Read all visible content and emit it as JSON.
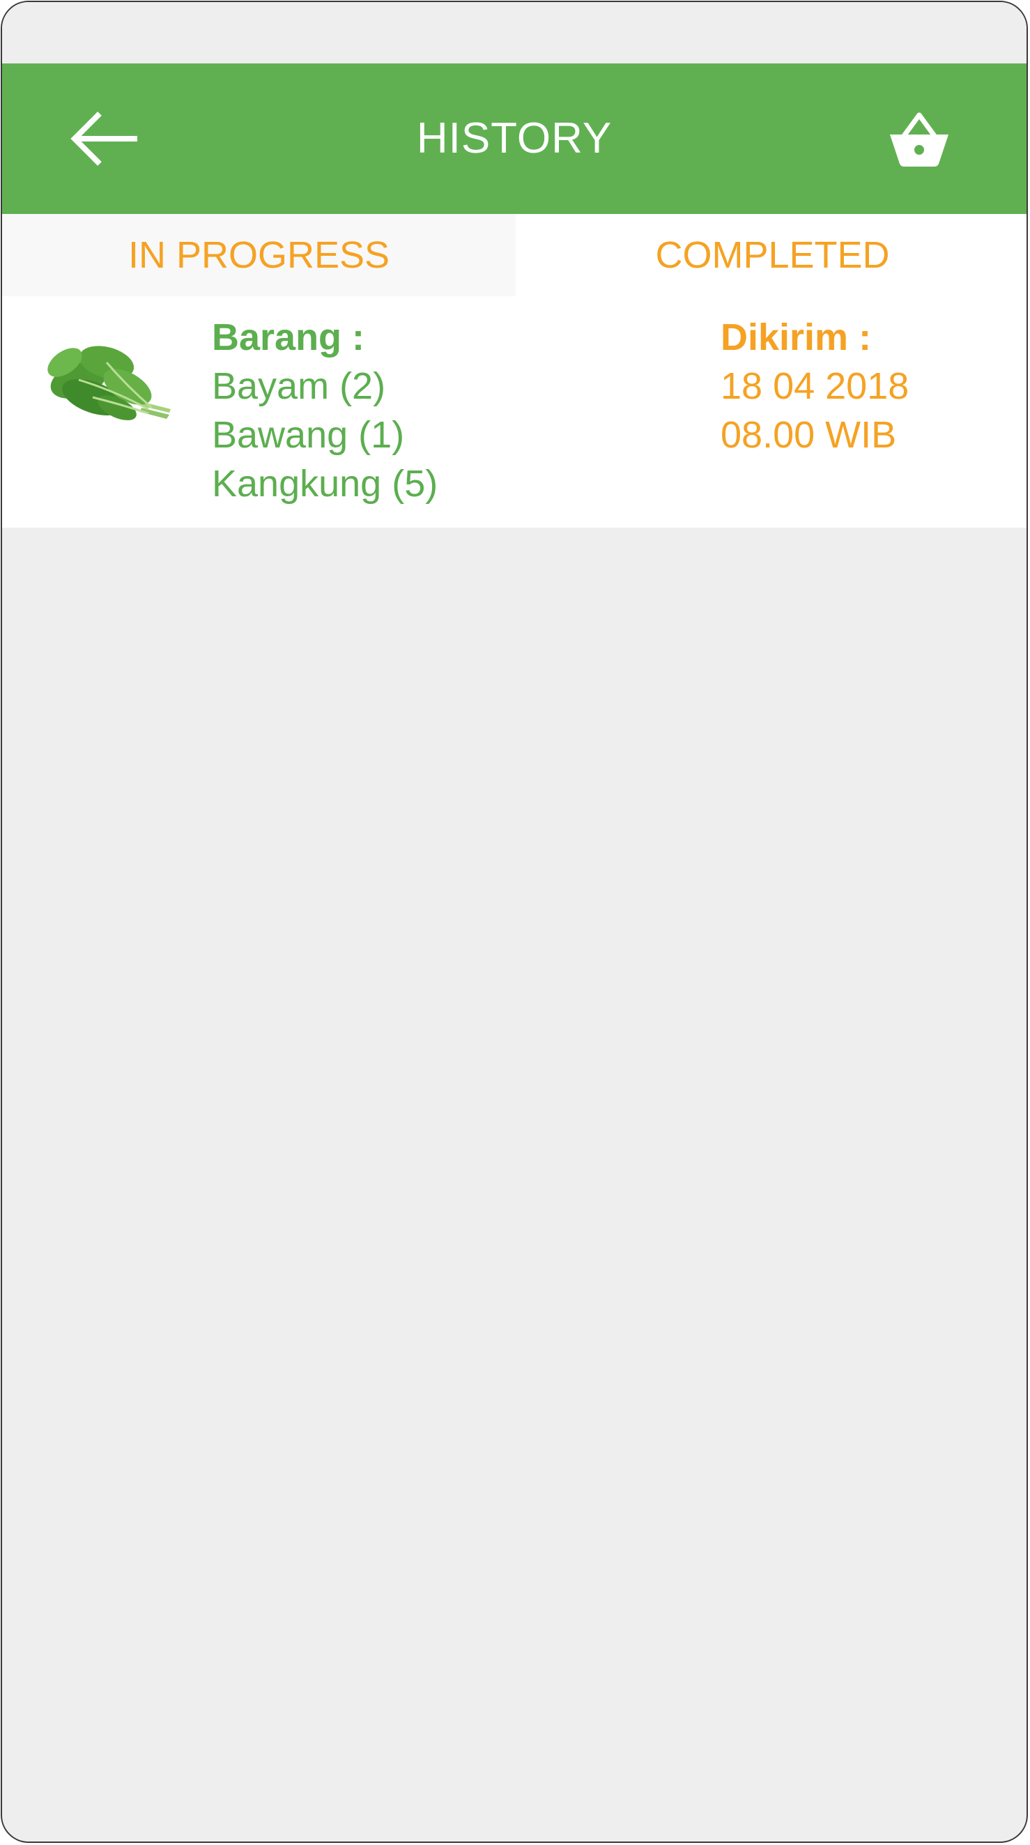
{
  "header": {
    "title": "HISTORY",
    "back_icon": "arrow-left-icon",
    "cart_icon": "basket-icon",
    "color": "#60b052"
  },
  "tabs": [
    {
      "label": "IN PROGRESS",
      "selected": true
    },
    {
      "label": "COMPLETED",
      "selected": false
    }
  ],
  "orders": [
    {
      "image": "spinach-bunch",
      "items_label": "Barang :",
      "items": [
        "Bayam (2)",
        "Bawang (1)",
        "Kangkung (5)"
      ],
      "shipped_label": "Dikirim :",
      "date": "18 04 2018",
      "time": "08.00 WIB"
    }
  ],
  "colors": {
    "green": "#5cae4f",
    "orange": "#f5a223",
    "background": "#eeeeee"
  }
}
